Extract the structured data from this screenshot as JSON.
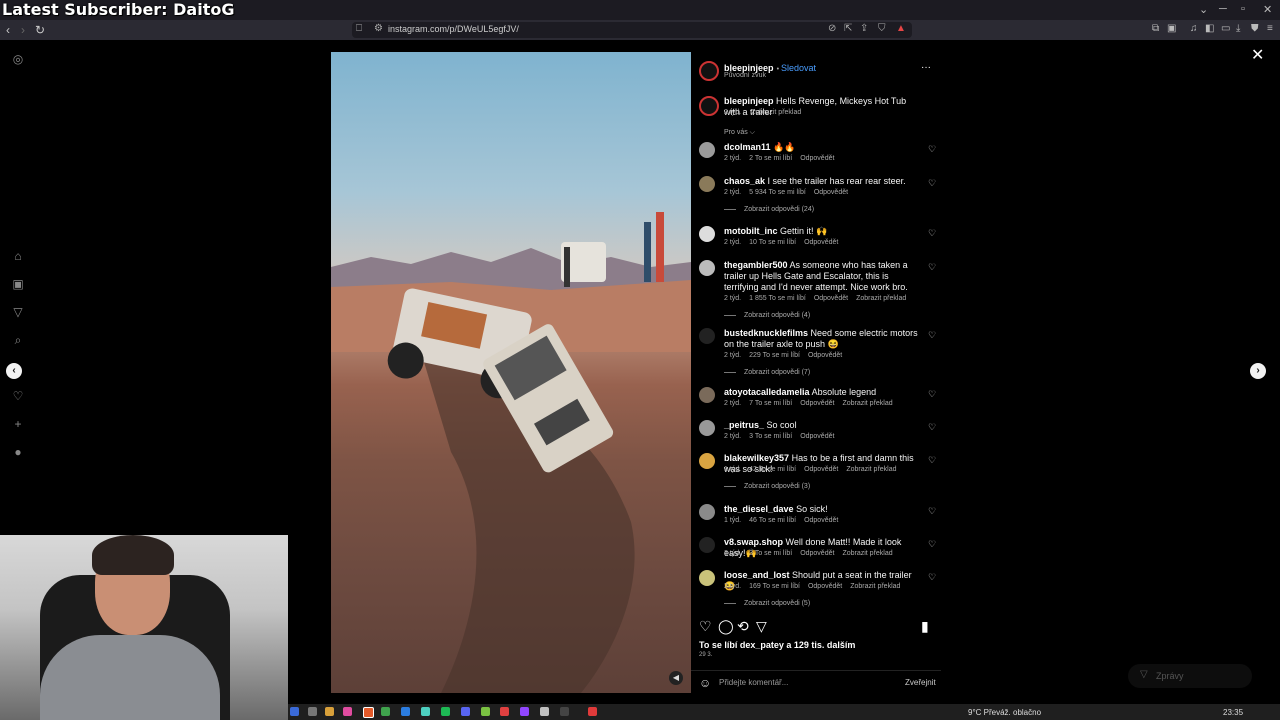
{
  "overlay": {
    "title": "Latest Subscriber: DaitoG"
  },
  "browser": {
    "url": "instagram.com/p/DWeUL5egfJV/",
    "window_controls": [
      "⌄",
      "─",
      "▫",
      "✕"
    ]
  },
  "post": {
    "author": "bleepinjeep",
    "follow_label": "Sledovat",
    "audio": "Původní zvuk",
    "more": "···",
    "caption_user": "bleepinjeep",
    "caption_text": "Hells Revenge, Mickeys Hot Tub with a trailer",
    "caption_time": "2 týd.",
    "caption_translate": "Zobrazit překlad",
    "sort_label": "Pro vás ⌵"
  },
  "comments": [
    {
      "user": "dcolman11",
      "text": "🔥🔥",
      "time": "2 týd.",
      "likes": "2 To se mi líbí",
      "reply": "Odpovědět",
      "translate": "",
      "replies": ""
    },
    {
      "user": "chaos_ak",
      "text": "I see the trailer has rear rear steer.",
      "time": "2 týd.",
      "likes": "5 934 To se mi líbí",
      "reply": "Odpovědět",
      "translate": "",
      "replies": "Zobrazit odpovědi (24)"
    },
    {
      "user": "motobilt_inc",
      "text": "Gettin it! 🙌",
      "time": "2 týd.",
      "likes": "10 To se mi líbí",
      "reply": "Odpovědět",
      "translate": "",
      "replies": ""
    },
    {
      "user": "thegambler500",
      "text": "As someone who has taken a trailer up Hells Gate and Escalator, this is terrifying and I'd never attempt. Nice work bro.",
      "time": "2 týd.",
      "likes": "1 855 To se mi líbí",
      "reply": "Odpovědět",
      "translate": "Zobrazit překlad",
      "replies": "Zobrazit odpovědi (4)"
    },
    {
      "user": "bustedknucklefilms",
      "text": "Need some electric motors on the trailer axle to push 😆",
      "time": "2 týd.",
      "likes": "229 To se mi líbí",
      "reply": "Odpovědět",
      "translate": "",
      "replies": "Zobrazit odpovědi (7)"
    },
    {
      "user": "atoyotacalledamelia",
      "text": "Absolute legend",
      "time": "2 týd.",
      "likes": "7 To se mi líbí",
      "reply": "Odpovědět",
      "translate": "Zobrazit překlad",
      "replies": ""
    },
    {
      "user": "_peitrus_",
      "text": "So cool",
      "time": "2 týd.",
      "likes": "3 To se mi líbí",
      "reply": "Odpovědět",
      "translate": "",
      "replies": ""
    },
    {
      "user": "blakewilkey357",
      "text": "Has to be a first and damn this was so sick!",
      "time": "1 týd.",
      "likes": "42 To se mi líbí",
      "reply": "Odpovědět",
      "translate": "Zobrazit překlad",
      "replies": "Zobrazit odpovědi (3)"
    },
    {
      "user": "the_diesel_dave",
      "text": "So sick!",
      "time": "1 týd.",
      "likes": "46 To se mi líbí",
      "reply": "Odpovědět",
      "translate": "",
      "replies": ""
    },
    {
      "user": "v8.swap.shop",
      "text": "Well done Matt!! Made it look easy!🙌",
      "time": "2 týd.",
      "likes": "3 To se mi líbí",
      "reply": "Odpovědět",
      "translate": "Zobrazit překlad",
      "replies": ""
    },
    {
      "user": "loose_and_lost",
      "text": "Should put a seat in the trailer 😆",
      "time": "2 týd.",
      "likes": "169 To se mi líbí",
      "reply": "Odpovědět",
      "translate": "Zobrazit překlad",
      "replies": "Zobrazit odpovědi (5)"
    }
  ],
  "engagement": {
    "likes_text": "To se líbí dex_patey a 129 tis. dalším",
    "date": "29 3."
  },
  "comment_box": {
    "placeholder": "Přidejte komentář...",
    "post_label": "Zveřejnit"
  },
  "messages": {
    "label": "Zprávy"
  },
  "taskbar": {
    "weather": "9°C  Převáž. oblačno",
    "time": "23:35"
  },
  "colors": {
    "accent": "#4a9eff",
    "background": "#000000",
    "panel": "#000000"
  }
}
